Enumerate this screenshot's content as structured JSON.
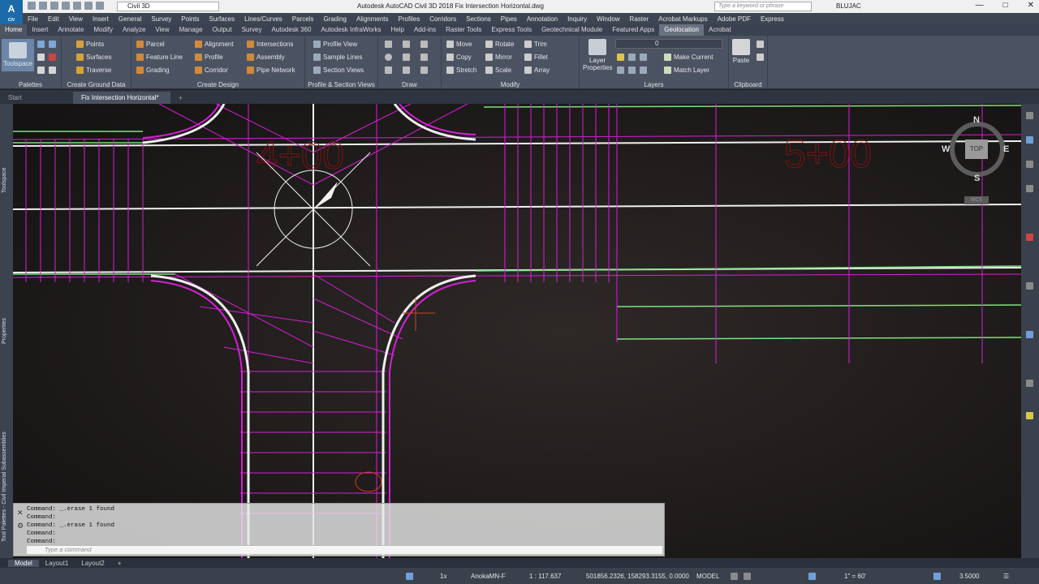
{
  "titlebar": {
    "logo": "A",
    "logo_sub": "CIV",
    "workspace": "Civil 3D",
    "title": "Autodesk AutoCAD Civil 3D 2018   Fix Intersection Horizontal.dwg",
    "search_placeholder": "Type a keyword or phrase",
    "user": "BLUJAC"
  },
  "menubar": [
    "File",
    "Edit",
    "View",
    "Insert",
    "General",
    "Survey",
    "Points",
    "Surfaces",
    "Lines/Curves",
    "Parcels",
    "Grading",
    "Alignments",
    "Profiles",
    "Corridors",
    "Sections",
    "Pipes",
    "Annotation",
    "Inquiry",
    "Window",
    "Raster",
    "Acrobat Markups",
    "Adobe PDF",
    "Express"
  ],
  "ribbon_tabs": [
    "Home",
    "Insert",
    "Annotate",
    "Modify",
    "Analyze",
    "View",
    "Manage",
    "Output",
    "Survey",
    "Autodesk 360",
    "Autodesk InfraWorks",
    "Help",
    "Add-ins",
    "Raster Tools",
    "Express Tools",
    "Geotechnical Module",
    "Featured Apps",
    "Geolocation",
    "Acrobat"
  ],
  "ribbon": {
    "toolspace": "Toolspace",
    "palettes": "Palettes",
    "ground": {
      "points": "Points",
      "surfaces": "Surfaces",
      "traverse": "Traverse",
      "title": "Create Ground Data"
    },
    "design": {
      "parcel": "Parcel",
      "feature_line": "Feature Line",
      "grading": "Grading",
      "alignment": "Alignment",
      "profile": "Profile",
      "corridor": "Corridor",
      "intersections": "Intersections",
      "assembly": "Assembly",
      "pipe_network": "Pipe Network",
      "title": "Create Design"
    },
    "profsec": {
      "profile_view": "Profile View",
      "sample_lines": "Sample Lines",
      "section_views": "Section Views",
      "title": "Profile & Section Views"
    },
    "draw": {
      "title": "Draw"
    },
    "modify": {
      "move": "Move",
      "copy": "Copy",
      "stretch": "Stretch",
      "rotate": "Rotate",
      "mirror": "Mirror",
      "scale": "Scale",
      "trim": "Trim",
      "fillet": "Fillet",
      "array": "Array",
      "title": "Modify"
    },
    "layers": {
      "layer_properties": "Layer Properties",
      "layer_value": "0",
      "make_current": "Make Current",
      "match_layer": "Match Layer",
      "title": "Layers"
    },
    "clipboard": {
      "paste": "Paste",
      "title": "Clipboard"
    }
  },
  "doc_tabs": [
    "Start",
    "Fix Intersection Horizontal*"
  ],
  "side_labels": {
    "toolspace": "Toolspace",
    "properties": "Properties",
    "tool_palettes": "Tool Palettes - Civil Imperial Subassemblies"
  },
  "drawing": {
    "station_left": "4+00",
    "station_right": "5+00",
    "viewcube": {
      "n": "N",
      "s": "S",
      "e": "E",
      "w": "W",
      "top": "TOP",
      "wcs": "WCS"
    }
  },
  "command_history": [
    "Command: _.erase 1 found",
    "Command:",
    "Command: _.erase 1 found",
    "Command:",
    "Command:"
  ],
  "command_placeholder": "Type a command",
  "layout_tabs": [
    "Model",
    "Layout1",
    "Layout2"
  ],
  "status": {
    "scale_view": "1x",
    "coord_system": "AnokaMN-F",
    "annotation_scale": "1 : 117.637",
    "coordinates": "501856.2326, 158293.3155, 0.0000",
    "model": "MODEL",
    "scale": "1\" = 60'",
    "zoom": "3.5000"
  },
  "colors": {
    "magenta": "#d61fd6",
    "green": "#7fe07f",
    "white": "#f0f0f0",
    "station": "#7a1414",
    "accent": "#1a6ba8"
  }
}
